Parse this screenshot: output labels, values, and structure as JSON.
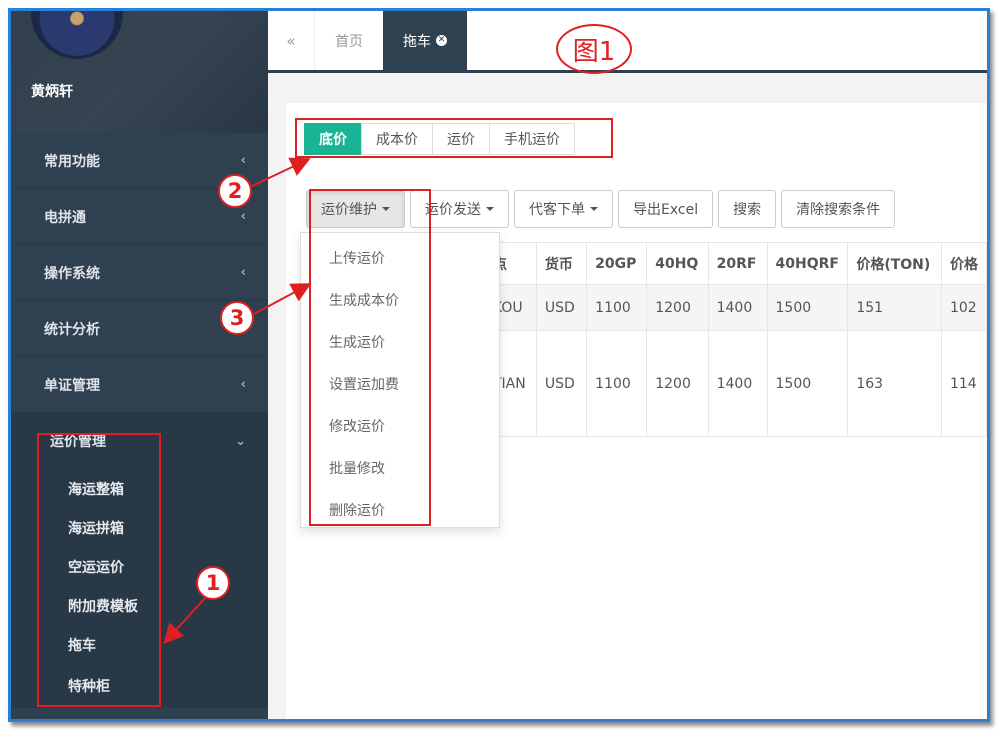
{
  "sidebar": {
    "username": "黄炳轩",
    "menu": [
      {
        "label": "常用功能",
        "chevron": "‹"
      },
      {
        "label": "电拼通",
        "chevron": "‹"
      },
      {
        "label": "操作系统",
        "chevron": "‹"
      },
      {
        "label": "统计分析",
        "chevron": "‹"
      },
      {
        "label": "单证管理",
        "chevron": "‹"
      }
    ],
    "open_menu": {
      "label": "运价管理",
      "chevron": "⌄",
      "items": [
        "海运整箱",
        "海运拼箱",
        "空运运价",
        "附加费模板",
        "拖车",
        "特种柜"
      ]
    }
  },
  "tabs": {
    "back_icon": "«",
    "home": "首页",
    "active": "拖车",
    "close_icon": "✕"
  },
  "segments": [
    "底价",
    "成本价",
    "运价",
    "手机运价"
  ],
  "toolbar": {
    "maintain": "运价维护",
    "send": "运价发送",
    "order": "代客下单",
    "export": "导出Excel",
    "search": "搜索",
    "clear": "清除搜索条件"
  },
  "dropdown": [
    "上传运价",
    "生成成本价",
    "生成运价",
    "设置运加费",
    "修改运价",
    "批量修改",
    "删除运价"
  ],
  "table": {
    "headers": [
      "点",
      "货币",
      "20GP",
      "40HQ",
      "20RF",
      "40HQRF",
      "价格(TON)",
      "价格"
    ],
    "rows": [
      [
        "KOU",
        "USD",
        "1100",
        "1200",
        "1400",
        "1500",
        "151",
        "102"
      ],
      [
        "TIAN",
        "USD",
        "1100",
        "1200",
        "1400",
        "1500",
        "163",
        "114"
      ]
    ]
  },
  "annotations": {
    "figure": "图1",
    "badge1": "1",
    "badge2": "2",
    "badge3": "3",
    "color": "#e02020"
  }
}
